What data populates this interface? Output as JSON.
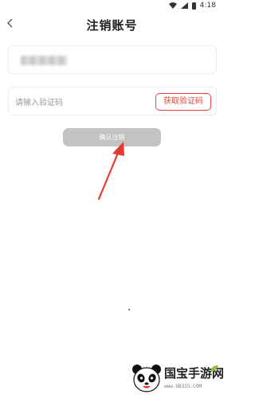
{
  "status_bar": {
    "time": "4:18"
  },
  "header": {
    "title": "注销账号",
    "back_icon": "chevron-left-icon"
  },
  "form": {
    "phone_masked": "",
    "code_placeholder": "请输入验证码",
    "get_code_label": "获取验证码",
    "confirm_label": "确认注销"
  },
  "watermark": {
    "title": "国宝手游网",
    "url": "www.GB315.COM"
  },
  "colors": {
    "accent_red": "#e0463d",
    "button_disabled": "#c3c3c3",
    "annotation_arrow": "#e33b31",
    "watermark_blue": "#2f6fc5"
  }
}
